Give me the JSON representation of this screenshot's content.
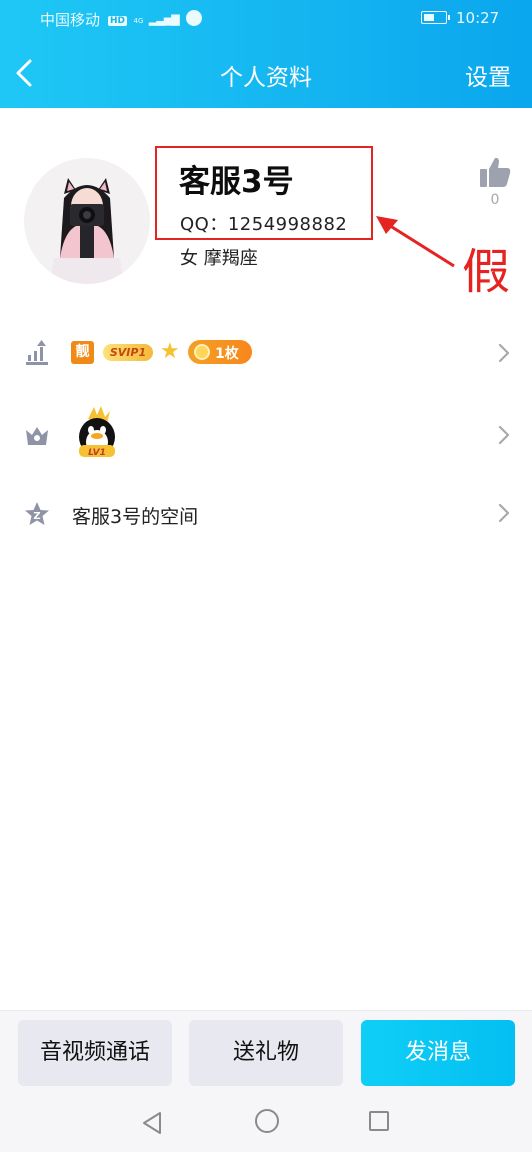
{
  "status_bar": {
    "carrier": "中国移动",
    "hd_badge": "HD",
    "network": "4G",
    "time": "10:27"
  },
  "header": {
    "back_icon": "chevron-left-icon",
    "title": "个人资料",
    "settings_label": "设置"
  },
  "profile": {
    "name": "客服3号",
    "qq": "QQ：1254998882",
    "gender_sign": "女  摩羯座",
    "like_count": "0",
    "annotation": "假",
    "annotation_color": "#e52320"
  },
  "rows": {
    "level": {
      "icon": "level-up-icon",
      "badge_jing": "靓",
      "badge_svip": "SVIP1",
      "badge_coin": "1枚"
    },
    "qq_level": {
      "icon": "crown-icon",
      "penguin_level": "LV1"
    },
    "space": {
      "icon": "star-icon",
      "label": "客服3号的空间"
    }
  },
  "actions": {
    "av_call": "音视频通话",
    "gift": "送礼物",
    "message": "发消息"
  },
  "colors": {
    "header_start": "#1ec8f5",
    "header_end": "#0aa6ee",
    "accent": "#04bff2",
    "highlight_red": "#e52320"
  }
}
